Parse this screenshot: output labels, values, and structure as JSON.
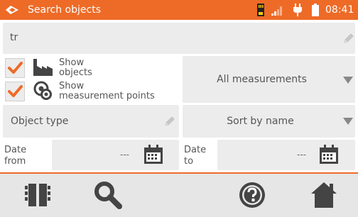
{
  "header": {
    "title": "Search objects",
    "time": "08:41",
    "status_icons": [
      "sd-card-icon",
      "signal-icon",
      "plug-icon",
      "battery-icon"
    ]
  },
  "search": {
    "value": "tr"
  },
  "filters": {
    "show_objects": {
      "label_line1": "Show",
      "label_line2": "objects",
      "checked": true
    },
    "show_points": {
      "label_line1": "Show",
      "label_line2": "measurement points",
      "checked": true
    },
    "measurement_type": "All measurements",
    "object_type_placeholder": "Object type",
    "sort": "Sort by name"
  },
  "dates": {
    "from_line1": "Date",
    "from_line2": "from",
    "from_value": "---",
    "to_line1": "Date",
    "to_line2": "to",
    "to_value": "---"
  },
  "colors": {
    "accent": "#ee6b27",
    "field_bg": "#ececec",
    "icon_dark": "#444444"
  },
  "bottom_icons": [
    "memory-icon",
    "search-icon",
    "help-icon",
    "home-icon"
  ]
}
